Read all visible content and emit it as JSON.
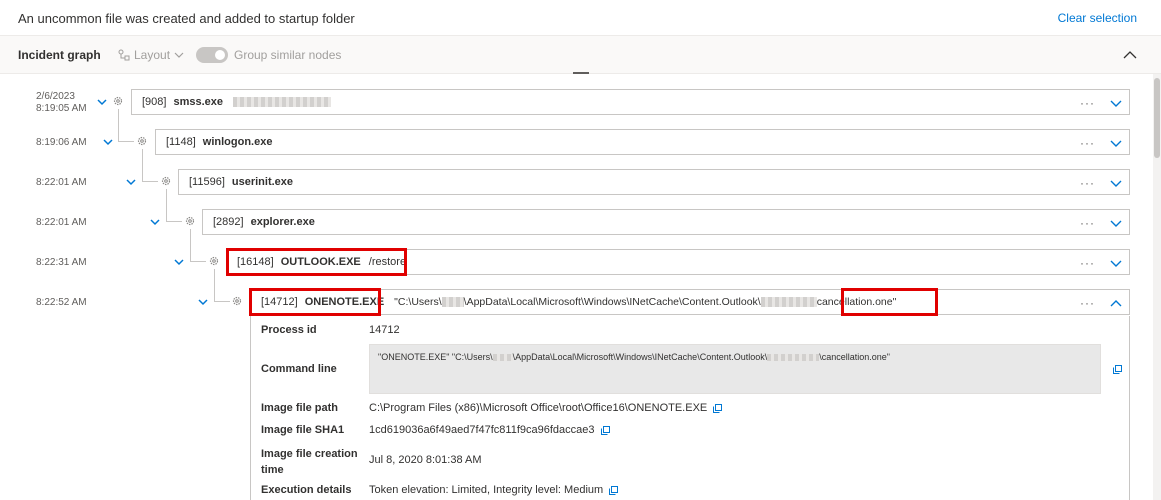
{
  "header": {
    "title": "An uncommon file was created and added to startup folder",
    "clear_selection": "Clear selection"
  },
  "graph": {
    "title": "Incident graph",
    "layout_label": "Layout",
    "group_similar_label": "Group similar nodes"
  },
  "rows": [
    {
      "time": "8:19:05 AM",
      "date": "2/6/2023",
      "pid": "[908]",
      "name": "smss.exe",
      "args": ""
    },
    {
      "time": "8:19:06 AM",
      "pid": "[1148]",
      "name": "winlogon.exe",
      "args": ""
    },
    {
      "time": "8:22:01 AM",
      "pid": "[11596]",
      "name": "userinit.exe",
      "args": ""
    },
    {
      "time": "8:22:01 AM",
      "pid": "[2892]",
      "name": "explorer.exe",
      "args": ""
    },
    {
      "time": "8:22:31 AM",
      "pid": "[16148]",
      "name": "OUTLOOK.EXE",
      "args": "/restore"
    },
    {
      "time": "8:22:52 AM",
      "pid": "[14712]",
      "name": "ONENOTE.EXE",
      "args_pre": "\"C:\\Users\\",
      "args_mid": "\\AppData\\Local\\Microsoft\\Windows\\INetCache\\Content.Outlook\\",
      "args_post": "cancellation.one\""
    }
  ],
  "details": {
    "process_id_label": "Process id",
    "process_id": "14712",
    "command_line_label": "Command line",
    "command_line_pre": "\"ONENOTE.EXE\" \"C:\\Users\\",
    "command_line_mid": "\\AppData\\Local\\Microsoft\\Windows\\INetCache\\Content.Outlook\\",
    "command_line_post": "\\cancellation.one\"",
    "image_path_label": "Image file path",
    "image_path": "C:\\Program Files (x86)\\Microsoft Office\\root\\Office16\\ONENOTE.EXE",
    "sha1_label": "Image file SHA1",
    "sha1": "1cd619036a6f49aed7f47fc811f9ca96fdaccae3",
    "creation_label_1": "Image file creation",
    "creation_label_2": "time",
    "creation_time": "Jul 8, 2020 8:01:38 AM",
    "exec_label": "Execution details",
    "exec_details": "Token elevation: Limited, Integrity level: Medium"
  },
  "ellipsis": "···",
  "colors": {
    "accent": "#0078d4",
    "highlight": "#e00000"
  }
}
